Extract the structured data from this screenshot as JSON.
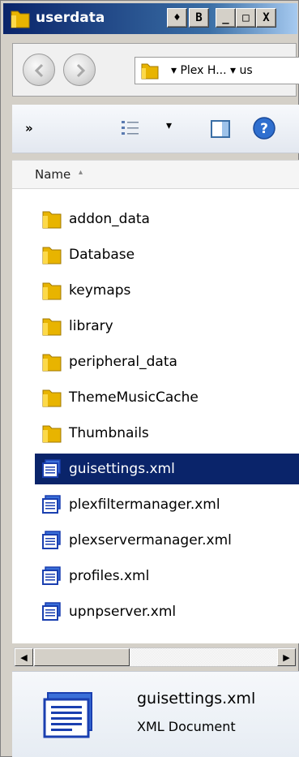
{
  "window": {
    "title": "userdata"
  },
  "titlebar_buttons": {
    "restore_label": "♦",
    "menu_label": "B",
    "minimize_label": "_",
    "maximize_label": "□",
    "close_label": "X"
  },
  "address_bar": {
    "path_text": "▾ Plex H... ▾ us"
  },
  "toolbar": {
    "overflow_label": "»",
    "view_dropdown_label": "▾"
  },
  "column_header": {
    "name_label": "Name",
    "sort_indicator": "▴"
  },
  "files": [
    {
      "name": "addon_data",
      "type": "folder",
      "selected": false
    },
    {
      "name": "Database",
      "type": "folder",
      "selected": false
    },
    {
      "name": "keymaps",
      "type": "folder",
      "selected": false
    },
    {
      "name": "library",
      "type": "folder",
      "selected": false
    },
    {
      "name": "peripheral_data",
      "type": "folder",
      "selected": false
    },
    {
      "name": "ThemeMusicCache",
      "type": "folder",
      "selected": false
    },
    {
      "name": "Thumbnails",
      "type": "folder",
      "selected": false
    },
    {
      "name": "guisettings.xml",
      "type": "xml",
      "selected": true
    },
    {
      "name": "plexfiltermanager.xml",
      "type": "xml",
      "selected": false
    },
    {
      "name": "plexservermanager.xml",
      "type": "xml",
      "selected": false
    },
    {
      "name": "profiles.xml",
      "type": "xml",
      "selected": false
    },
    {
      "name": "upnpserver.xml",
      "type": "xml",
      "selected": false
    }
  ],
  "scrollbar": {
    "left_arrow": "◀",
    "right_arrow": "▶"
  },
  "details": {
    "file_name": "guisettings.xml",
    "file_type": "XML Document"
  },
  "colors": {
    "selection": "#0a246a",
    "folder": "#e8b400",
    "xml_icon": "#1a3fb0"
  }
}
